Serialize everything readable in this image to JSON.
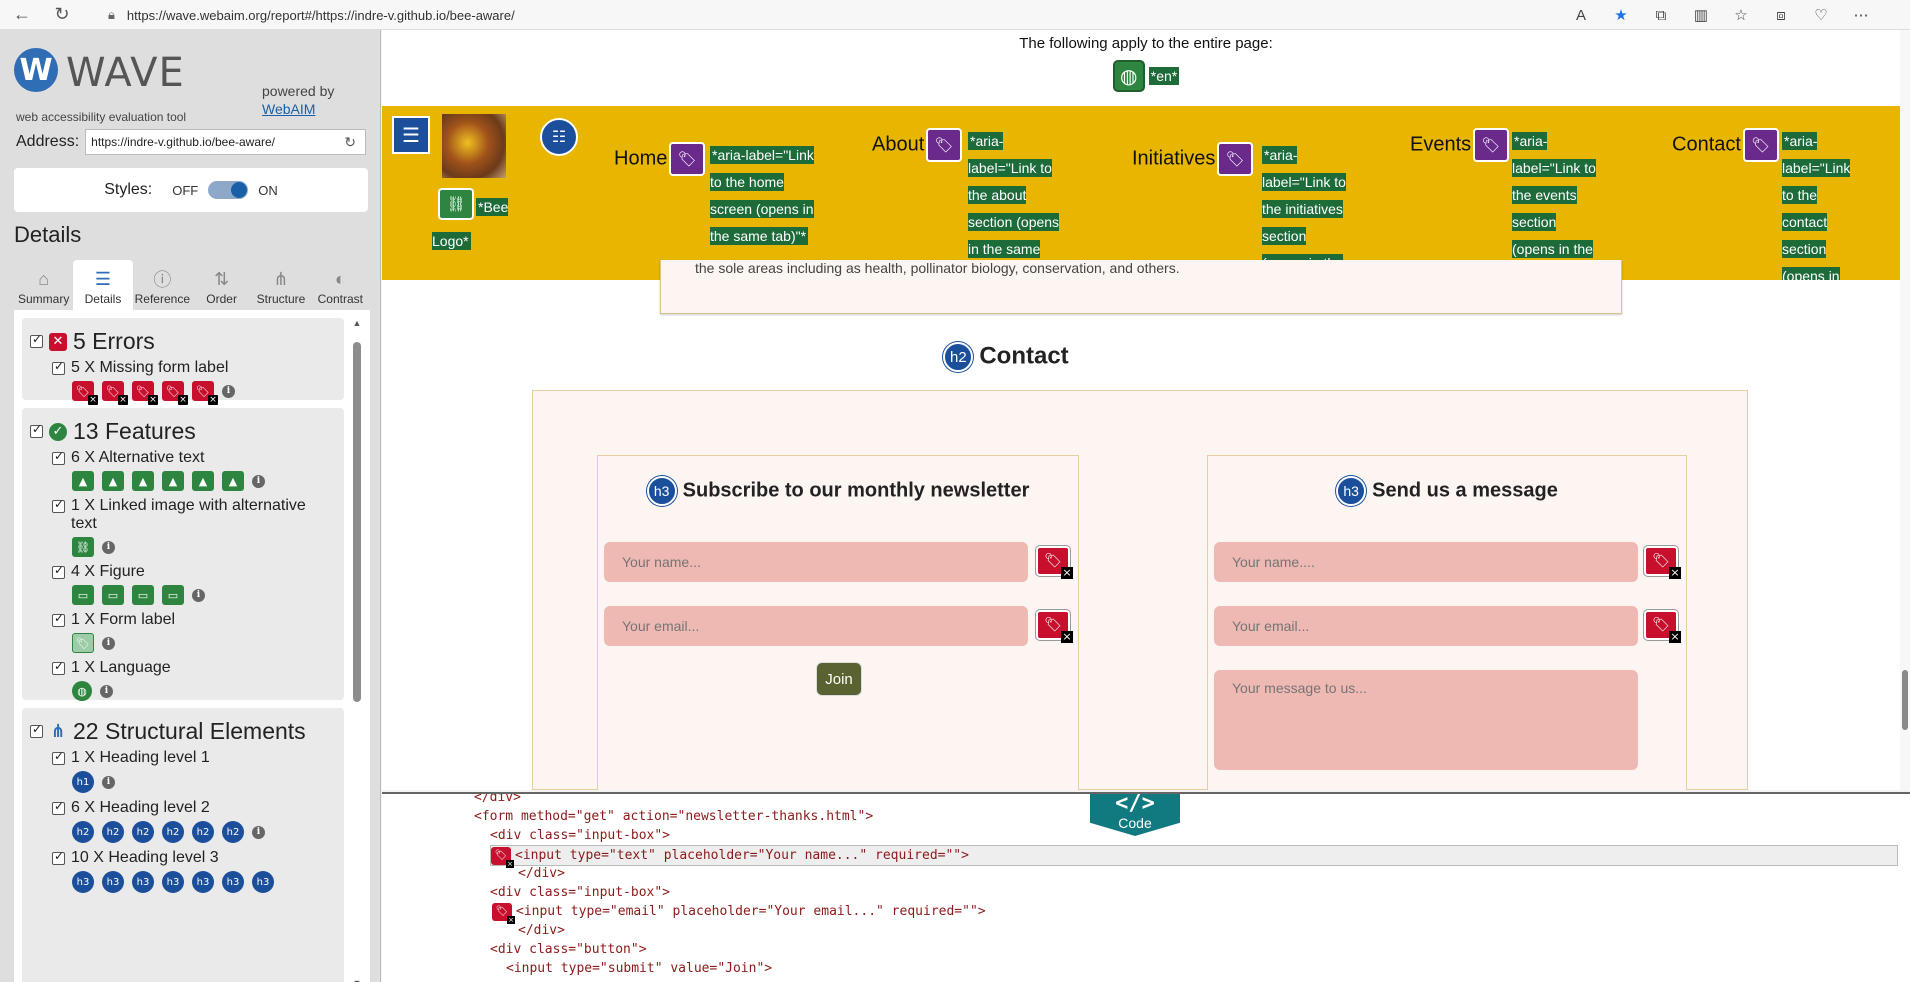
{
  "browser": {
    "url": "https://wave.webaim.org/report#/https://indre-v.github.io/bee-aware/"
  },
  "wave": {
    "wordmark": "WAVE",
    "logo_letter": "W",
    "tagline": "web accessibility evaluation tool",
    "powered_by": "powered by",
    "webaim_link": "WebAIM",
    "address_label": "Address:",
    "address_value": "https://indre-v.github.io/bee-aware/",
    "styles_label": "Styles:",
    "styles_off": "OFF",
    "styles_on": "ON",
    "details_title": "Details",
    "tabs": [
      {
        "label": "Summary",
        "icon": "home-icon"
      },
      {
        "label": "Details",
        "icon": "list-icon"
      },
      {
        "label": "Reference",
        "icon": "info-icon"
      },
      {
        "label": "Order",
        "icon": "order-icon"
      },
      {
        "label": "Structure",
        "icon": "structure-icon"
      },
      {
        "label": "Contrast",
        "icon": "contrast-icon"
      }
    ],
    "errors": {
      "title": "5 Errors",
      "items": [
        {
          "label": "5 X Missing form label"
        }
      ]
    },
    "features": {
      "title": "13 Features",
      "items": [
        {
          "label": "6 X Alternative text"
        },
        {
          "label": "1 X Linked image with alternative text"
        },
        {
          "label": "4 X Figure"
        },
        {
          "label": "1 X Form label"
        },
        {
          "label": "1 X Language"
        }
      ]
    },
    "structural": {
      "title": "22 Structural Elements",
      "items": [
        {
          "label": "1 X Heading level 1"
        },
        {
          "label": "6 X Heading level 2"
        },
        {
          "label": "10 X Heading level 3"
        }
      ]
    },
    "heading_badges": {
      "h1": "h1",
      "h2": "h2",
      "h3": "h3"
    },
    "colors": {
      "error": "#c8102e",
      "feature": "#2e8540",
      "structure": "#1b4f9c",
      "aria": "#6a2a8c"
    }
  },
  "page": {
    "entire_page_note": "The following apply to the entire page:",
    "lang_label": "*en*",
    "bee_logo_label": "*Bee Logo*",
    "nav": [
      {
        "label": "Home",
        "aria": "*aria-label=\"Link to the home screen (opens in the same tab)\"*"
      },
      {
        "label": "About",
        "aria": "*aria-label=\"Link to the about section (opens in the same tab)\"*"
      },
      {
        "label": "Initiatives",
        "aria": "*aria-label=\"Link to the initiatives section (opens in the same tab)\"*"
      },
      {
        "label": "Events",
        "aria": "*aria-label=\"Link to the events section (opens in the same tab)\"*"
      },
      {
        "label": "Contact",
        "aria": "*aria-label=\"Link to the contact section (opens in the same tab)\"*"
      }
    ],
    "prev_section_text": "the sole areas including as health, pollinator biology, conservation, and others.",
    "contact_heading": "Contact",
    "newsletter": {
      "heading": "Subscribe to our monthly newsletter",
      "name_placeholder": "Your name...",
      "email_placeholder": "Your email...",
      "join": "Join"
    },
    "message": {
      "heading": "Send us a message",
      "name_placeholder": "Your name....",
      "email_placeholder": "Your email...",
      "message_placeholder": "Your message to us..."
    }
  },
  "code": {
    "tab_symbol": "</>",
    "tab_label": "Code",
    "lines": [
      "</div>",
      "<form method=\"get\" action=\"newsletter-thanks.html\">",
      "<div class=\"input-box\">",
      "<input type=\"text\" placeholder=\"Your name...\" required=\"\">",
      "</div>",
      "<div class=\"input-box\">",
      "<input type=\"email\" placeholder=\"Your email...\" required=\"\">",
      "</div>",
      "<div class=\"button\">",
      "<input type=\"submit\" value=\"Join\">"
    ]
  }
}
